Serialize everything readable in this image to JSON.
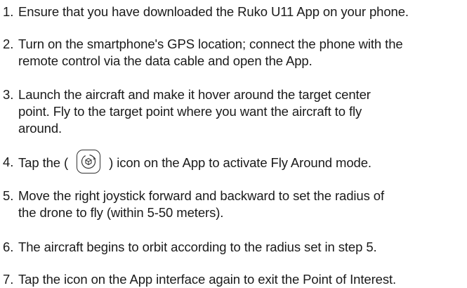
{
  "steps": [
    {
      "num": "1.",
      "lines": [
        "Ensure that you have downloaded the Ruko U11 App on your phone."
      ]
    },
    {
      "num": "2.",
      "lines": [
        "Turn on the smartphone's GPS location; connect the phone with the",
        "remote control via the data cable and open the App."
      ]
    },
    {
      "num": "3.",
      "lines": [
        "Launch the aircraft and make it hover around the target center",
        "point. Fly to the target point where you want the aircraft to fly",
        "around."
      ]
    },
    {
      "num": "4.",
      "before_icon": "Tap the (",
      "icon": "fly-around-icon",
      "after_icon": ") icon on the App to activate Fly Around mode."
    },
    {
      "num": "5.",
      "lines": [
        "Move the right joystick forward and backward to set the radius of",
        "the drone to fly (within 5-50 meters)."
      ]
    },
    {
      "num": "6.",
      "lines": [
        "The aircraft begins to orbit according to the radius set in step 5."
      ]
    },
    {
      "num": "7.",
      "lines": [
        "Tap the icon on the App interface again to exit the Point of Interest."
      ]
    }
  ]
}
